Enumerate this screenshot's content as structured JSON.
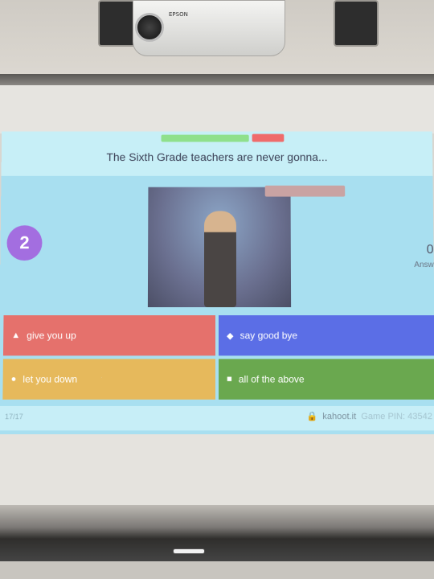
{
  "projector": {
    "brand": "EPSON"
  },
  "quiz": {
    "question": "The Sixth Grade teachers are never gonna...",
    "timer": "2",
    "answers_count": "0",
    "answers_label": "Answ",
    "answers": [
      {
        "shape": "triangle",
        "symbol": "▲",
        "label": "give you up",
        "color": "#e5716c"
      },
      {
        "shape": "diamond",
        "symbol": "◆",
        "label": "say good bye",
        "color": "#5b6ee6"
      },
      {
        "shape": "circle",
        "symbol": "●",
        "label": "let you down",
        "color": "#e6b95c"
      },
      {
        "shape": "square",
        "symbol": "■",
        "label": "all of the above",
        "color": "#6aa84f"
      }
    ],
    "footer": {
      "counter": "17/17",
      "site": "kahoot.it",
      "pin_label": "Game PIN: 43542"
    }
  }
}
